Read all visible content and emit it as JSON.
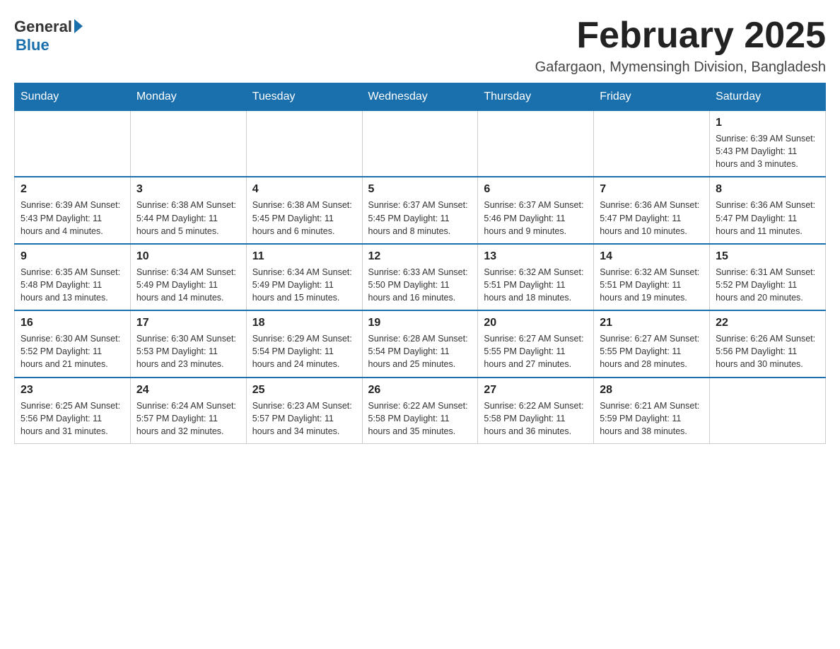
{
  "logo": {
    "general": "General",
    "blue": "Blue"
  },
  "title": "February 2025",
  "location": "Gafargaon, Mymensingh Division, Bangladesh",
  "days_of_week": [
    "Sunday",
    "Monday",
    "Tuesday",
    "Wednesday",
    "Thursday",
    "Friday",
    "Saturday"
  ],
  "weeks": [
    [
      {
        "day": "",
        "info": ""
      },
      {
        "day": "",
        "info": ""
      },
      {
        "day": "",
        "info": ""
      },
      {
        "day": "",
        "info": ""
      },
      {
        "day": "",
        "info": ""
      },
      {
        "day": "",
        "info": ""
      },
      {
        "day": "1",
        "info": "Sunrise: 6:39 AM\nSunset: 5:43 PM\nDaylight: 11 hours and 3 minutes."
      }
    ],
    [
      {
        "day": "2",
        "info": "Sunrise: 6:39 AM\nSunset: 5:43 PM\nDaylight: 11 hours and 4 minutes."
      },
      {
        "day": "3",
        "info": "Sunrise: 6:38 AM\nSunset: 5:44 PM\nDaylight: 11 hours and 5 minutes."
      },
      {
        "day": "4",
        "info": "Sunrise: 6:38 AM\nSunset: 5:45 PM\nDaylight: 11 hours and 6 minutes."
      },
      {
        "day": "5",
        "info": "Sunrise: 6:37 AM\nSunset: 5:45 PM\nDaylight: 11 hours and 8 minutes."
      },
      {
        "day": "6",
        "info": "Sunrise: 6:37 AM\nSunset: 5:46 PM\nDaylight: 11 hours and 9 minutes."
      },
      {
        "day": "7",
        "info": "Sunrise: 6:36 AM\nSunset: 5:47 PM\nDaylight: 11 hours and 10 minutes."
      },
      {
        "day": "8",
        "info": "Sunrise: 6:36 AM\nSunset: 5:47 PM\nDaylight: 11 hours and 11 minutes."
      }
    ],
    [
      {
        "day": "9",
        "info": "Sunrise: 6:35 AM\nSunset: 5:48 PM\nDaylight: 11 hours and 13 minutes."
      },
      {
        "day": "10",
        "info": "Sunrise: 6:34 AM\nSunset: 5:49 PM\nDaylight: 11 hours and 14 minutes."
      },
      {
        "day": "11",
        "info": "Sunrise: 6:34 AM\nSunset: 5:49 PM\nDaylight: 11 hours and 15 minutes."
      },
      {
        "day": "12",
        "info": "Sunrise: 6:33 AM\nSunset: 5:50 PM\nDaylight: 11 hours and 16 minutes."
      },
      {
        "day": "13",
        "info": "Sunrise: 6:32 AM\nSunset: 5:51 PM\nDaylight: 11 hours and 18 minutes."
      },
      {
        "day": "14",
        "info": "Sunrise: 6:32 AM\nSunset: 5:51 PM\nDaylight: 11 hours and 19 minutes."
      },
      {
        "day": "15",
        "info": "Sunrise: 6:31 AM\nSunset: 5:52 PM\nDaylight: 11 hours and 20 minutes."
      }
    ],
    [
      {
        "day": "16",
        "info": "Sunrise: 6:30 AM\nSunset: 5:52 PM\nDaylight: 11 hours and 21 minutes."
      },
      {
        "day": "17",
        "info": "Sunrise: 6:30 AM\nSunset: 5:53 PM\nDaylight: 11 hours and 23 minutes."
      },
      {
        "day": "18",
        "info": "Sunrise: 6:29 AM\nSunset: 5:54 PM\nDaylight: 11 hours and 24 minutes."
      },
      {
        "day": "19",
        "info": "Sunrise: 6:28 AM\nSunset: 5:54 PM\nDaylight: 11 hours and 25 minutes."
      },
      {
        "day": "20",
        "info": "Sunrise: 6:27 AM\nSunset: 5:55 PM\nDaylight: 11 hours and 27 minutes."
      },
      {
        "day": "21",
        "info": "Sunrise: 6:27 AM\nSunset: 5:55 PM\nDaylight: 11 hours and 28 minutes."
      },
      {
        "day": "22",
        "info": "Sunrise: 6:26 AM\nSunset: 5:56 PM\nDaylight: 11 hours and 30 minutes."
      }
    ],
    [
      {
        "day": "23",
        "info": "Sunrise: 6:25 AM\nSunset: 5:56 PM\nDaylight: 11 hours and 31 minutes."
      },
      {
        "day": "24",
        "info": "Sunrise: 6:24 AM\nSunset: 5:57 PM\nDaylight: 11 hours and 32 minutes."
      },
      {
        "day": "25",
        "info": "Sunrise: 6:23 AM\nSunset: 5:57 PM\nDaylight: 11 hours and 34 minutes."
      },
      {
        "day": "26",
        "info": "Sunrise: 6:22 AM\nSunset: 5:58 PM\nDaylight: 11 hours and 35 minutes."
      },
      {
        "day": "27",
        "info": "Sunrise: 6:22 AM\nSunset: 5:58 PM\nDaylight: 11 hours and 36 minutes."
      },
      {
        "day": "28",
        "info": "Sunrise: 6:21 AM\nSunset: 5:59 PM\nDaylight: 11 hours and 38 minutes."
      },
      {
        "day": "",
        "info": ""
      }
    ]
  ]
}
